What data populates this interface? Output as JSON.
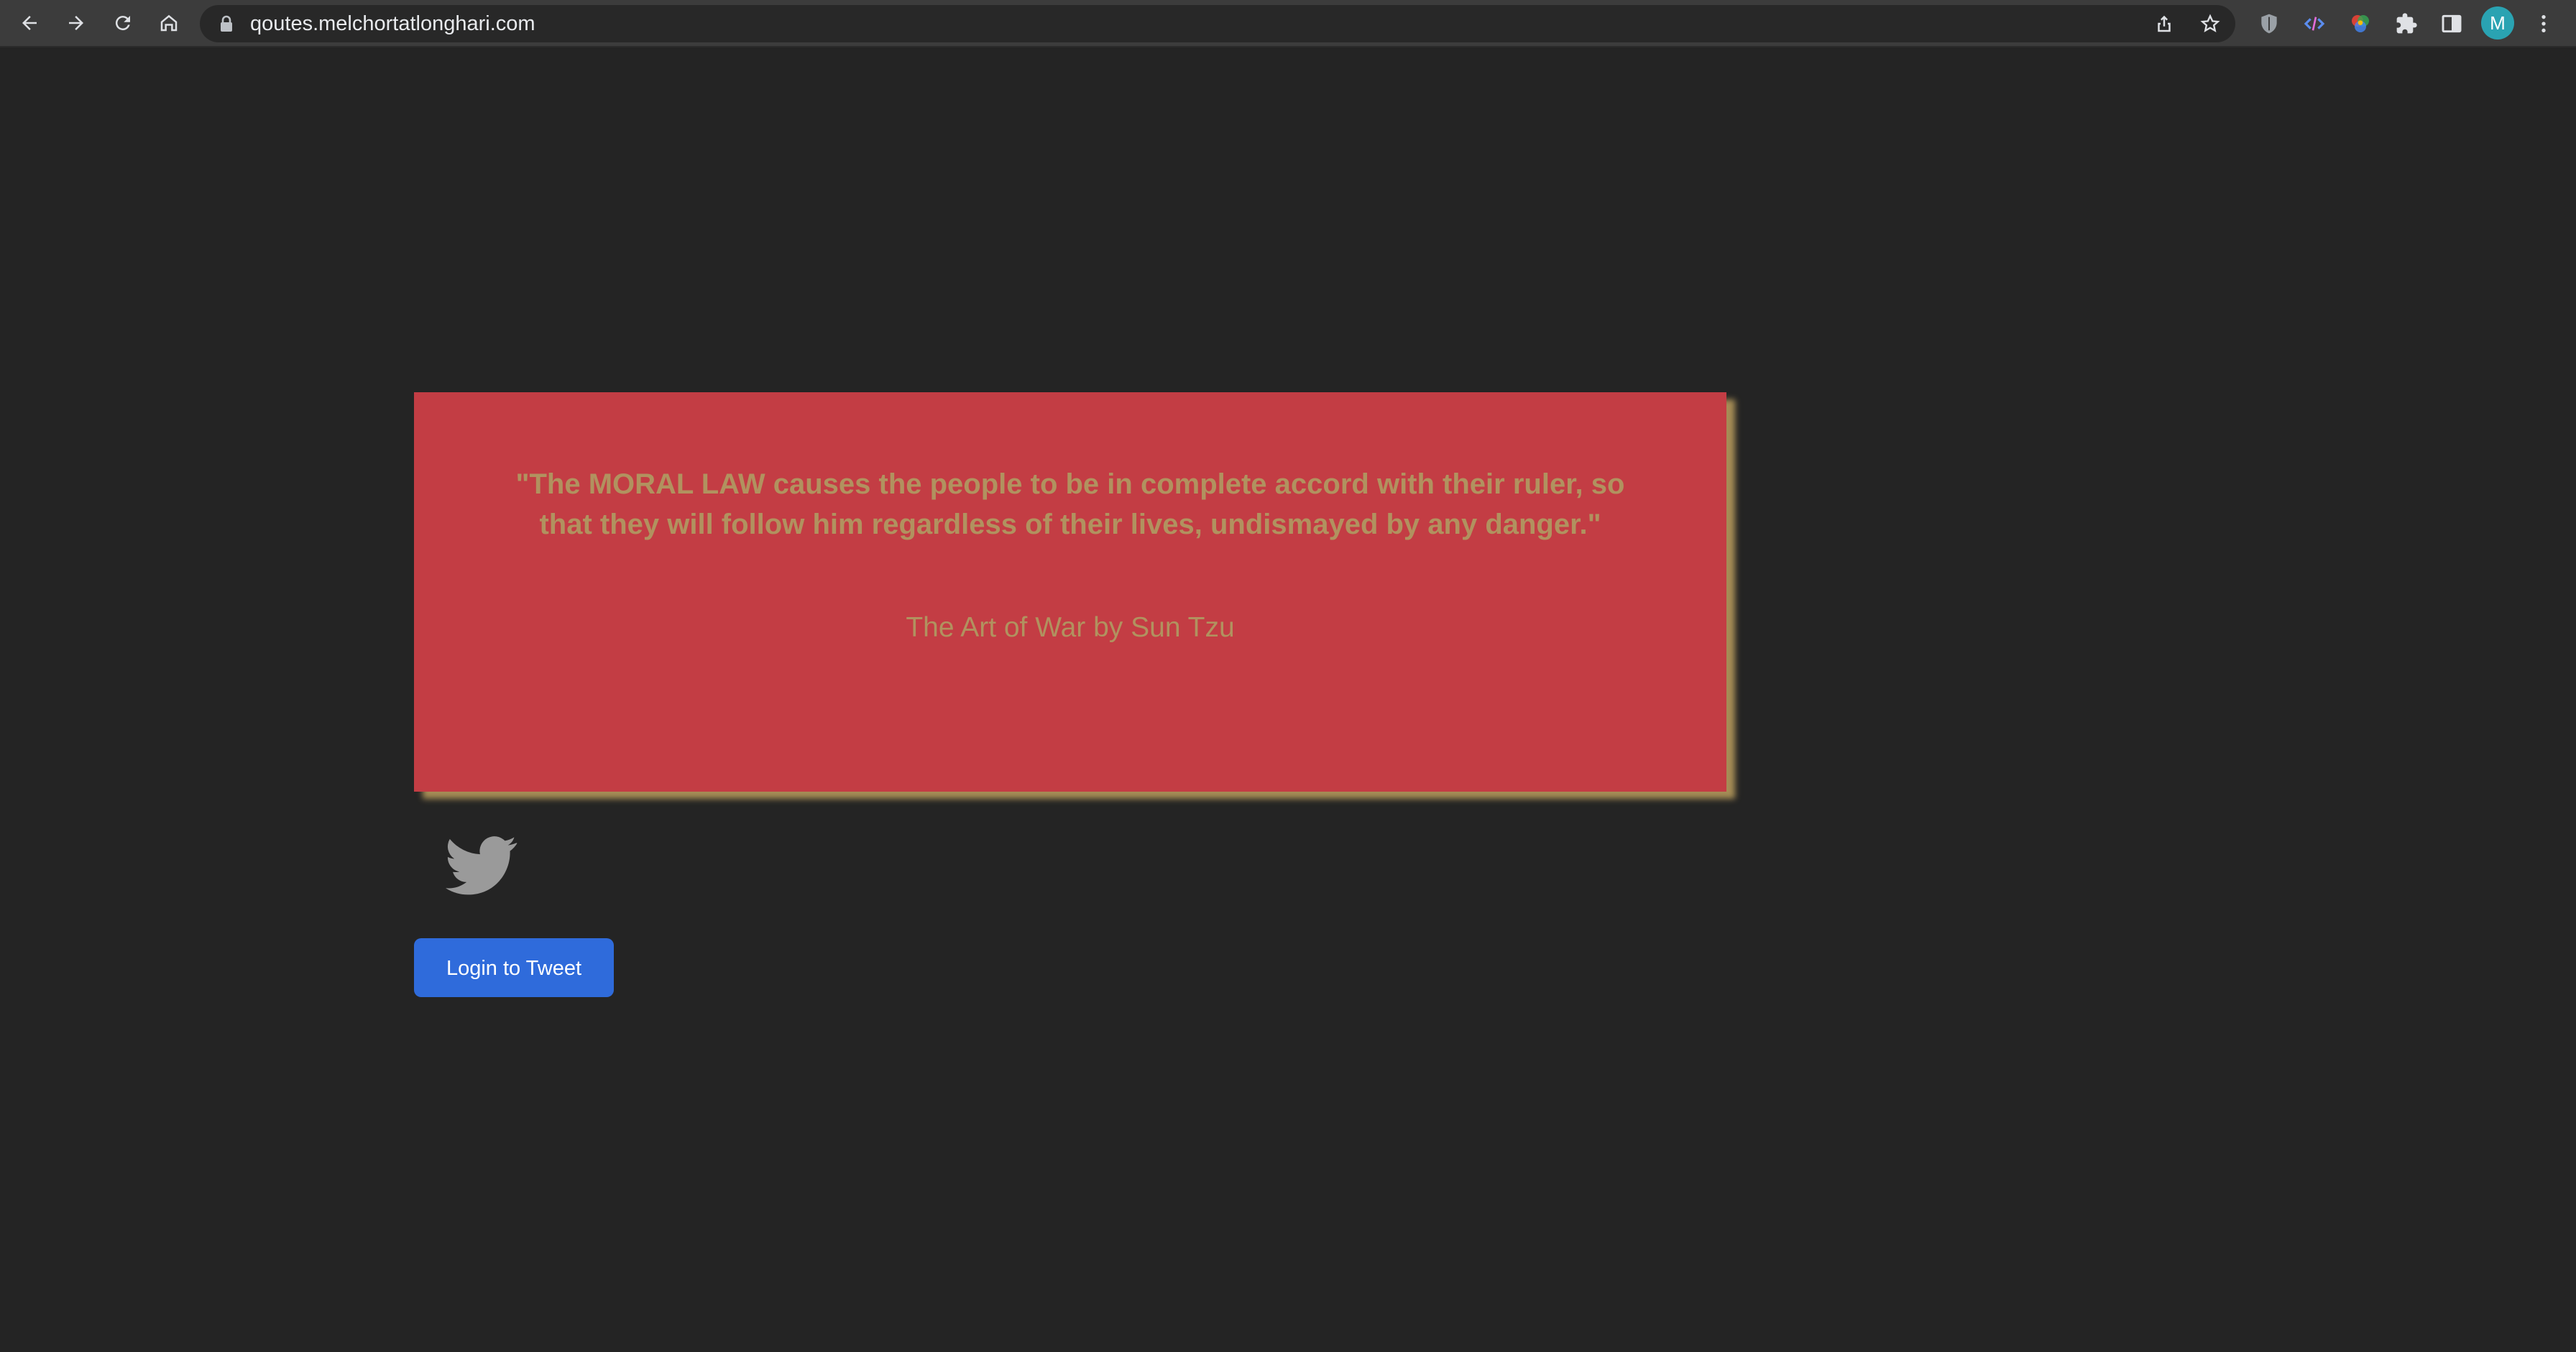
{
  "browser": {
    "url": "qoutes.melchortatlonghari.com",
    "avatar_initial": "M",
    "icons": [
      "back-arrow-icon",
      "forward-arrow-icon",
      "reload-icon",
      "home-icon",
      "lock-icon",
      "share-icon",
      "bookmark-star-icon",
      "shield-extension-icon",
      "code-extension-icon",
      "color-wheel-extension-icon",
      "puzzle-extensions-icon",
      "side-panel-icon",
      "kebab-menu-icon"
    ]
  },
  "quote": {
    "text": "\"The MORAL LAW causes the people to be in complete accord with their ruler, so that they will follow him regardless of their lives, undismayed by any danger.\"",
    "author": "The Art of War by Sun Tzu"
  },
  "actions": {
    "tweet_label": "Login to Tweet"
  },
  "colors": {
    "page_background": "#242424",
    "card_background": "#c33d44",
    "quote_text": "#b1925f",
    "button": "#2f6bdb",
    "twitter_icon": "#9a9a9a"
  }
}
